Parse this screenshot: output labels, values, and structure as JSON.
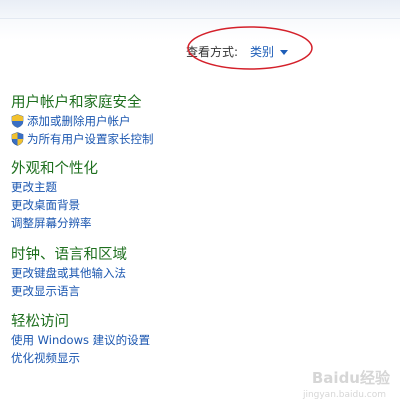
{
  "header": {
    "view_by_label": "查看方式:",
    "view_by_value": "类别"
  },
  "sections": [
    {
      "title": "用户帐户和家庭安全",
      "links": [
        {
          "label": "添加或删除用户帐户",
          "icon": "shield-icon"
        },
        {
          "label": "为所有用户设置家长控制",
          "icon": "shield-icon"
        }
      ]
    },
    {
      "title": "外观和个性化",
      "links": [
        {
          "label": "更改主题"
        },
        {
          "label": "更改桌面背景"
        },
        {
          "label": "调整屏幕分辨率"
        }
      ]
    },
    {
      "title": "时钟、语言和区域",
      "links": [
        {
          "label": "更改键盘或其他输入法"
        },
        {
          "label": "更改显示语言"
        }
      ]
    },
    {
      "title": "轻松访问",
      "links": [
        {
          "label": "使用 Windows 建议的设置"
        },
        {
          "label": "优化视频显示"
        }
      ]
    }
  ],
  "watermark": {
    "text": "Baidu经验",
    "sub": "jingyan.baidu.com"
  },
  "colors": {
    "section_title": "#1e6f1e",
    "link": "#1a56b0",
    "annotation": "#d4202a"
  }
}
